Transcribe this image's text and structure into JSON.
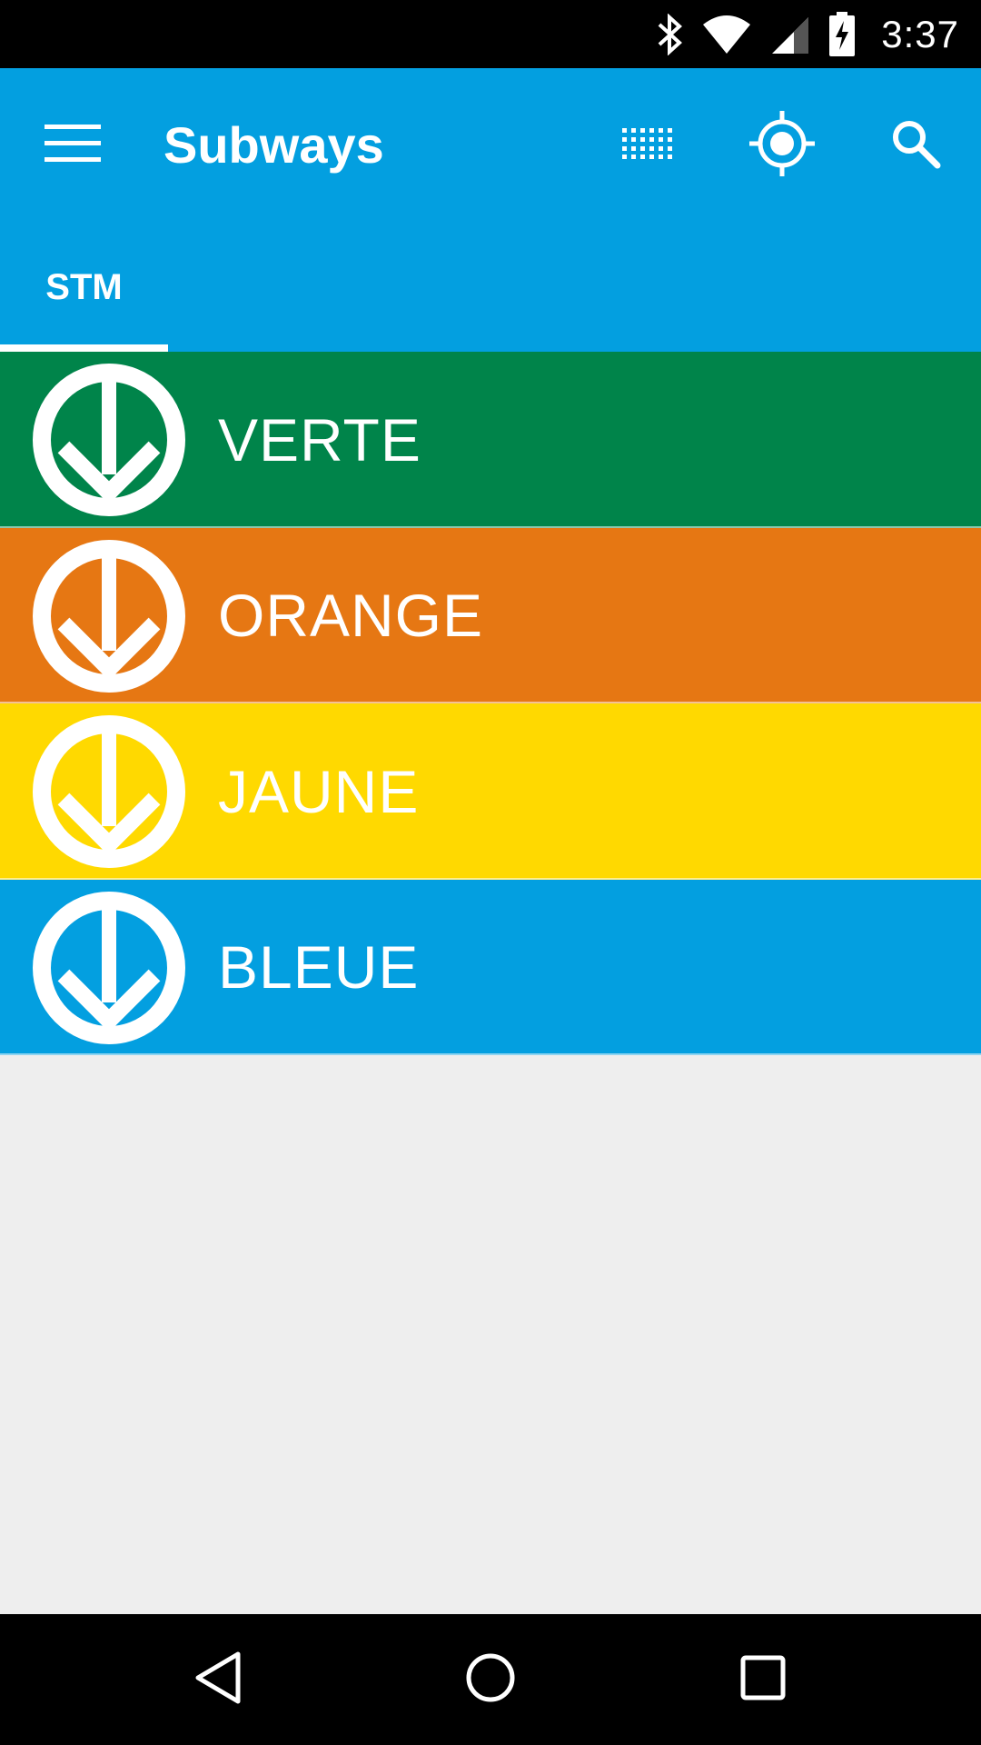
{
  "status_bar": {
    "time": "3:37",
    "icons": [
      "bluetooth-icon",
      "wifi-icon",
      "cell-signal-icon",
      "battery-charging-icon"
    ]
  },
  "app_bar": {
    "title": "Subways",
    "color": "#039fe0",
    "actions": [
      "grid-icon",
      "my-location-icon",
      "search-icon"
    ]
  },
  "tabs": [
    {
      "label": "STM",
      "selected": true
    }
  ],
  "lines": [
    {
      "name": "VERTE",
      "color": "#00844a"
    },
    {
      "name": "ORANGE",
      "color": "#e67713"
    },
    {
      "name": "JAUNE",
      "color": "#ffd900"
    },
    {
      "name": "BLEUE",
      "color": "#039fe0"
    }
  ],
  "nav_bar": {
    "buttons": [
      "back-icon",
      "home-icon",
      "recents-icon"
    ]
  }
}
